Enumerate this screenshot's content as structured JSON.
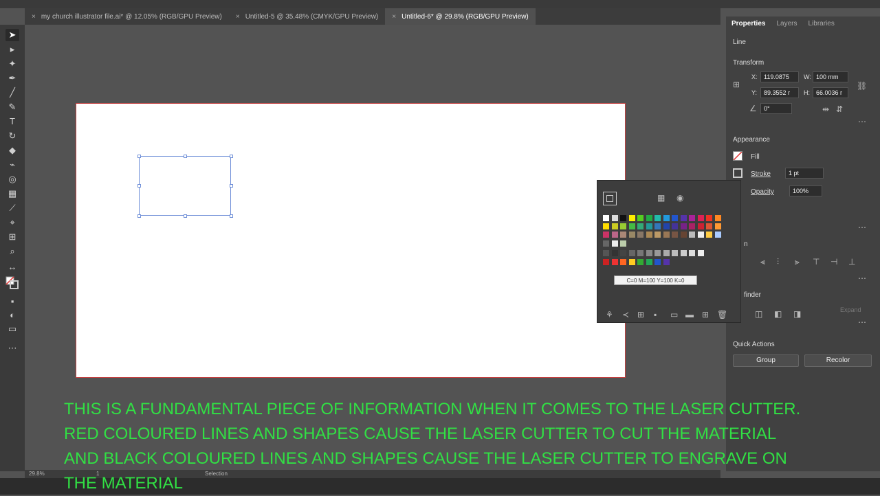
{
  "tabs": [
    {
      "label": "my church illustrator file.ai* @ 12.05% (RGB/GPU Preview)"
    },
    {
      "label": "Untitled-5 @ 35.48% (CMYK/GPU Preview)"
    },
    {
      "label": "Untitled-6* @ 29.8% (RGB/GPU Preview)"
    }
  ],
  "tab_close": "×",
  "panel": {
    "tabs": [
      "Properties",
      "Layers",
      "Libraries"
    ],
    "selection_type": "Line",
    "transform": {
      "title": "Transform",
      "x_label": "X:",
      "x_value": "119.0875",
      "y_label": "Y:",
      "y_value": "89.3552 r",
      "w_label": "W:",
      "w_value": "100 mm",
      "h_label": "H:",
      "h_value": "66.0036 r",
      "angle_value": "0°"
    },
    "appearance": {
      "title": "Appearance",
      "fill_label": "Fill",
      "stroke_label": "Stroke",
      "stroke_value": "1 pt",
      "opacity_label": "Opacity",
      "opacity_value": "100%"
    },
    "align_partial": "n",
    "pathfinder_partial": "finder",
    "expand_label": "Expand",
    "quick_actions": {
      "title": "Quick Actions",
      "group_label": "Group",
      "recolor_label": "Recolor"
    }
  },
  "swatch_tooltip": "C=0 M=100 Y=100 K=0",
  "status": {
    "zoom": "29.8%",
    "page": "1",
    "tool": "Selection"
  },
  "caption": "THIS IS A FUNDAMENTAL PIECE OF INFORMATION WHEN IT COMES TO THE LASER CUTTER. RED COLOURED LINES AND SHAPES CAUSE THE LASER CUTTER TO CUT THE MATERIAL AND BLACK COLOURED LINES AND SHAPES CAUSE THE LASER CUTTER TO ENGRAVE ON THE MATERIAL",
  "colors": {
    "caption": "#31e044",
    "artboard_border": "#c24040",
    "selection": "#6f8fd8"
  }
}
